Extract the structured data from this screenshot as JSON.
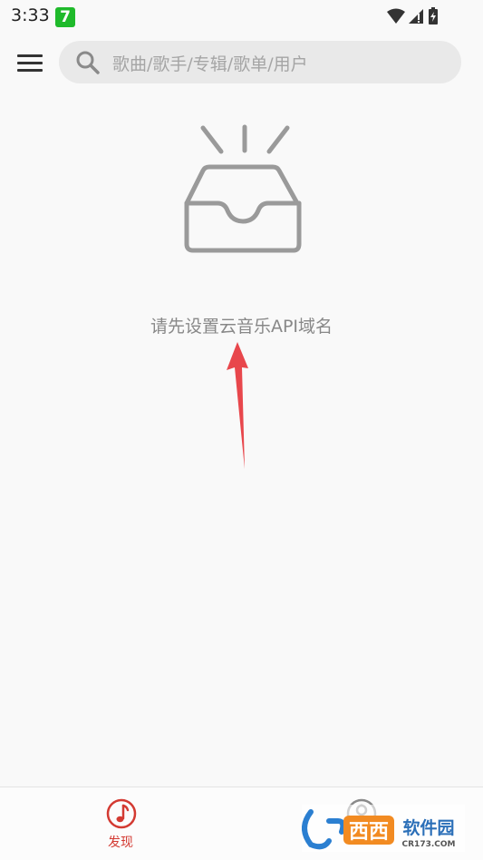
{
  "status_bar": {
    "time": "3:33",
    "app_badge": "7",
    "icons": [
      "wifi-icon",
      "signal-icon",
      "battery-icon"
    ]
  },
  "header": {
    "menu_icon": "menu-icon",
    "search": {
      "icon": "search-icon",
      "placeholder": "歌曲/歌手/专辑/歌单/用户"
    }
  },
  "main": {
    "empty_state": {
      "icon": "empty-box-icon",
      "message": "请先设置云音乐API域名"
    },
    "annotation": "red-arrow"
  },
  "bottom_nav": {
    "items": [
      {
        "label": "发现",
        "icon": "music-note-icon",
        "active": true
      },
      {
        "label": "",
        "icon": "user-icon",
        "active": false
      }
    ]
  },
  "watermark": {
    "text": "西西软件园",
    "sub": "CR173.COM"
  },
  "colors": {
    "background": "#f9f9f9",
    "accent": "#d33a32",
    "search_bg": "#e9e9e9",
    "arrow": "#e8474c"
  }
}
